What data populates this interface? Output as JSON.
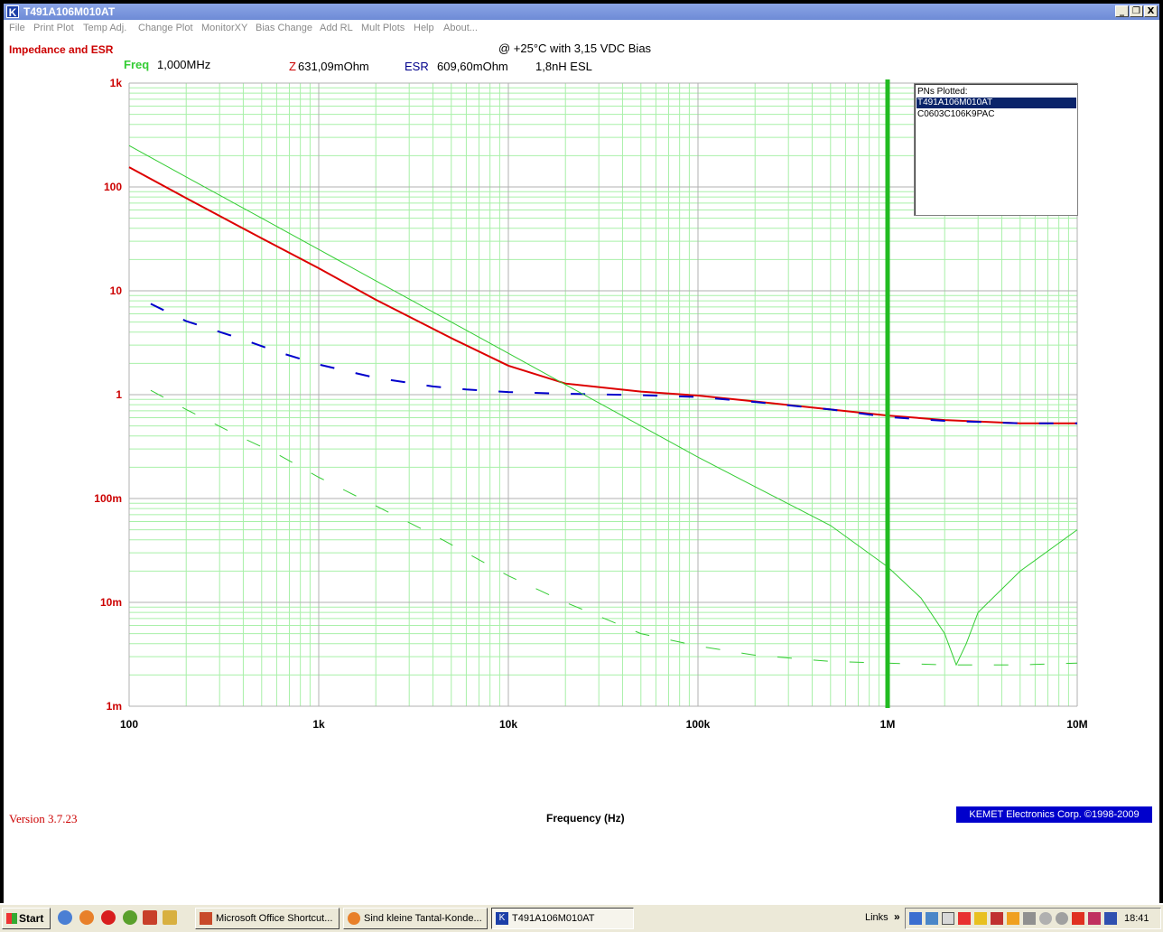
{
  "window": {
    "title": "T491A106M010AT",
    "buttons": [
      "_",
      "❐",
      "X"
    ]
  },
  "menu": [
    "File",
    "Print Plot",
    "Temp Adj.",
    "Change Plot",
    "MonitorXY",
    "Bias Change",
    "Add RL",
    "Mult Plots",
    "Help",
    "About..."
  ],
  "header": {
    "plot_name": "Impedance and ESR",
    "condition": "@ +25°C with 3,15 VDC Bias",
    "freq_label": "Freq",
    "freq_value": "1,000MHz",
    "z_label": "Z",
    "z_value": "631,09mOhm",
    "esr_label": "ESR",
    "esr_value": "609,60mOhm",
    "esl_value": "1,8nH ESL"
  },
  "legend": {
    "title": "PNs Plotted:",
    "items": [
      "T491A106M010AT",
      "C0603C106K9PAC"
    ],
    "selected": 0
  },
  "footer": {
    "version": "Version 3.7.23",
    "xlabel": "Frequency (Hz)",
    "copyright": "KEMET Electronics Corp. ©1998-2009"
  },
  "chart_data": {
    "type": "line",
    "x_scale": "log",
    "y_scale": "log",
    "xlim": [
      100,
      10000000
    ],
    "ylim": [
      0.001,
      1000
    ],
    "x_ticks": [
      100,
      1000,
      10000,
      100000,
      1000000,
      10000000
    ],
    "x_tick_labels": [
      "100",
      "1k",
      "10k",
      "100k",
      "1M",
      "10M"
    ],
    "y_ticks": [
      1000,
      100,
      10,
      1,
      0.1,
      0.01,
      0.001
    ],
    "y_tick_labels": [
      "1k",
      "100",
      "10",
      "1",
      "100m",
      "10m",
      "1m"
    ],
    "cursor_x": 1000000,
    "grid": true,
    "series": [
      {
        "name": "",
        "style": "solid",
        "color": "#dd0000",
        "x": [
          100,
          200,
          500,
          1000,
          2000,
          5000,
          10000,
          20000,
          50000,
          100000,
          200000,
          500000,
          1000000,
          2000000,
          5000000,
          10000000
        ],
        "y": [
          155,
          78,
          32,
          16.5,
          8.2,
          3.5,
          1.9,
          1.28,
          1.07,
          0.98,
          0.86,
          0.72,
          0.63,
          0.57,
          0.53,
          0.53
        ]
      },
      {
        "name": "",
        "style": "dashed",
        "color": "#0000cc",
        "x": [
          130,
          200,
          400,
          600,
          1000,
          2000,
          4000,
          6000,
          10000,
          20000,
          50000,
          100000,
          200000,
          500000,
          1000000,
          2000000,
          5000000,
          10000000
        ],
        "y": [
          7.5,
          5.1,
          3.4,
          2.6,
          1.95,
          1.45,
          1.2,
          1.12,
          1.06,
          1.02,
          0.99,
          0.95,
          0.85,
          0.72,
          0.61,
          0.56,
          0.53,
          0.53
        ]
      },
      {
        "name": "",
        "style": "solid",
        "color": "#33cc33",
        "x": [
          100,
          200,
          500,
          1000,
          2000,
          5000,
          10000,
          20000,
          50000,
          100000,
          200000,
          500000,
          1000000,
          1500000,
          2000000,
          2300000,
          2600000,
          3000000,
          5000000,
          10000000
        ],
        "y": [
          250,
          125,
          50,
          25,
          12.5,
          5,
          2.5,
          1.25,
          0.5,
          0.25,
          0.13,
          0.055,
          0.022,
          0.011,
          0.005,
          0.0025,
          0.004,
          0.008,
          0.02,
          0.05
        ]
      },
      {
        "name": "",
        "style": "dashed",
        "color": "#33cc33",
        "x": [
          130,
          200,
          400,
          600,
          1000,
          2000,
          4000,
          6000,
          10000,
          20000,
          50000,
          100000,
          200000,
          500000,
          1000000,
          2000000,
          5000000,
          10000000
        ],
        "y": [
          1.1,
          0.72,
          0.38,
          0.27,
          0.16,
          0.085,
          0.045,
          0.03,
          0.018,
          0.01,
          0.005,
          0.0038,
          0.0031,
          0.0027,
          0.0026,
          0.0025,
          0.0025,
          0.0026
        ]
      }
    ]
  },
  "taskbar": {
    "start": "Start",
    "tasks": [
      "Microsoft Office Shortcut...",
      "Sind kleine Tantal-Konde...",
      "T491A106M010AT"
    ],
    "links": "Links",
    "clock": "18:41"
  }
}
